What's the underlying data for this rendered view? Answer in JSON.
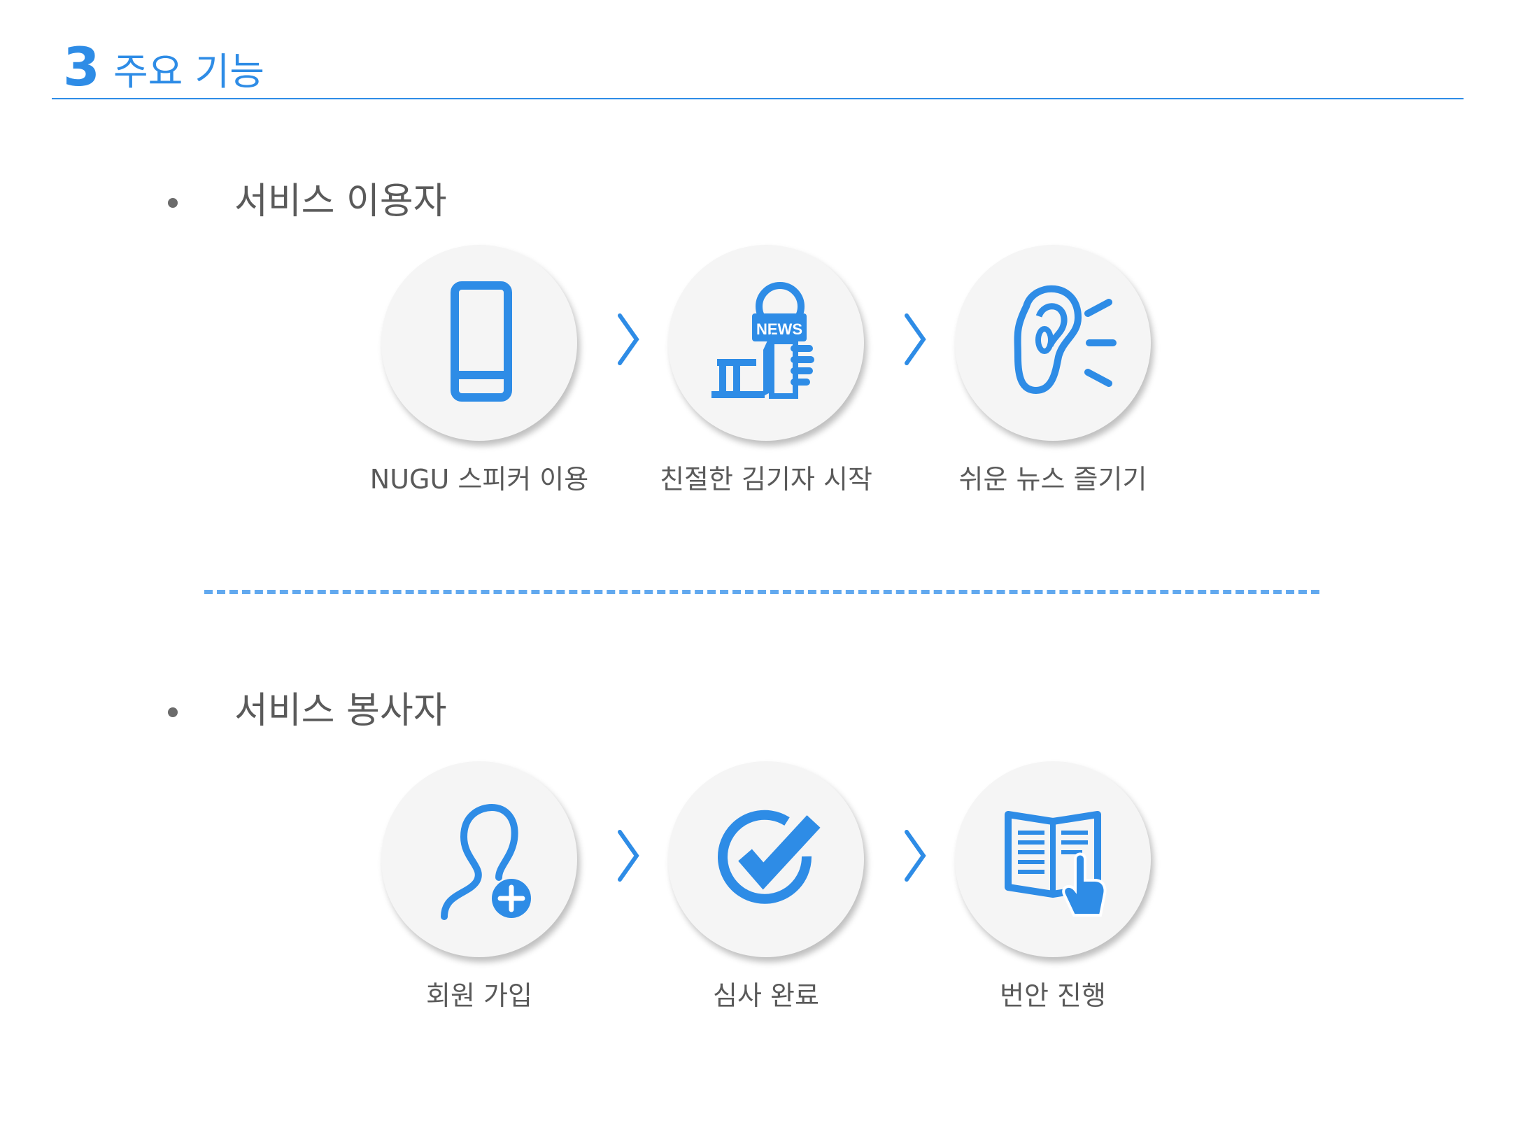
{
  "header": {
    "number": "3",
    "title": "주요 기능"
  },
  "colors": {
    "accent": "#2e8ce6",
    "circle_bg": "#f5f5f5",
    "text": "#5a5a5a",
    "divider": "#62a9ef"
  },
  "sections": [
    {
      "title": "서비스 이용자",
      "steps": [
        {
          "icon": "phone-icon",
          "label": "NUGU 스피커 이용"
        },
        {
          "icon": "news-reporter-icon",
          "label": "친절한 김기자 시작",
          "icon_text": "NEWS"
        },
        {
          "icon": "ear-listening-icon",
          "label": "쉬운 뉴스 즐기기"
        }
      ]
    },
    {
      "title": "서비스 봉사자",
      "steps": [
        {
          "icon": "add-user-icon",
          "label": "회원 가입"
        },
        {
          "icon": "check-circle-icon",
          "label": "심사 완료"
        },
        {
          "icon": "open-book-icon",
          "label": "번안 진행"
        }
      ]
    }
  ]
}
